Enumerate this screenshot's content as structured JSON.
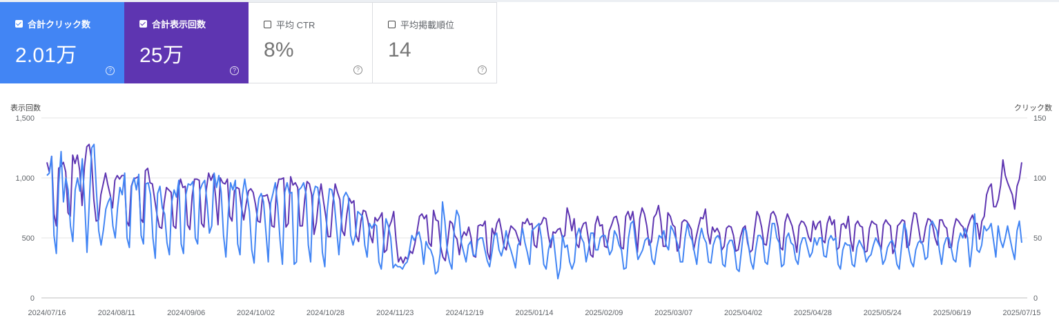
{
  "cards": [
    {
      "label": "合計クリック数",
      "value": "2.01万",
      "checked": true,
      "color": "#4285f4"
    },
    {
      "label": "合計表示回数",
      "value": "25万",
      "checked": true,
      "color": "#5e35b1"
    },
    {
      "label": "平均 CTR",
      "value": "8%",
      "checked": false
    },
    {
      "label": "平均掲載順位",
      "value": "14",
      "checked": false
    }
  ],
  "help_icon": "question-circle-icon",
  "chart_data": {
    "type": "line",
    "left_axis_label": "表示回数",
    "right_axis_label": "クリック数",
    "left_ylim": [
      0,
      1500
    ],
    "right_ylim": [
      0,
      150
    ],
    "left_ticks": [
      "1,500",
      "1,000",
      "500",
      "0"
    ],
    "right_ticks": [
      "150",
      "100",
      "50",
      "0"
    ],
    "x_ticks": [
      "2024/07/16",
      "2024/08/11",
      "2024/09/06",
      "2024/10/02",
      "2024/10/28",
      "2024/11/23",
      "2024/12/19",
      "2025/01/14",
      "2025/02/09",
      "2025/03/07",
      "2025/04/02",
      "2025/04/28",
      "2025/05/24",
      "2025/06/19",
      "2025/07/15"
    ],
    "x_start": "2024/07/16",
    "x_end": "2025/07/15",
    "grid": true,
    "series": [
      {
        "name": "表示回数",
        "axis": "left",
        "color": "#5e35b1",
        "values": [
          1130,
          1050,
          1180,
          700,
          600,
          1080,
          1100,
          1130,
          1050,
          710,
          680,
          1190,
          1120,
          1190,
          1060,
          770,
          1090,
          1260,
          1280,
          1160,
          820,
          640,
          650,
          860,
          950,
          1040,
          940,
          860,
          750,
          980,
          1020,
          990,
          1020,
          1020,
          640,
          600,
          930,
          990,
          1000,
          1010,
          660,
          630,
          1060,
          1080,
          960,
          950,
          820,
          690,
          590,
          580,
          790,
          920,
          900,
          880,
          600,
          580,
          900,
          990,
          920,
          930,
          610,
          570,
          850,
          990,
          990,
          980,
          620,
          590,
          900,
          1040,
          980,
          1030,
          840,
          610,
          1000,
          960,
          950,
          990,
          680,
          640,
          890,
          920,
          910,
          760,
          650,
          780,
          890,
          910,
          880,
          780,
          640,
          630,
          850,
          850,
          860,
          780,
          600,
          590,
          900,
          990,
          990,
          1000,
          590,
          620,
          1010,
          940,
          960,
          920,
          600,
          600,
          820,
          970,
          950,
          860,
          530,
          630,
          830,
          950,
          810,
          680,
          510,
          510,
          780,
          950,
          880,
          820,
          560,
          520,
          700,
          830,
          790,
          810,
          520,
          470,
          640,
          730,
          720,
          640,
          520,
          460,
          670,
          640,
          670,
          710,
          380,
          400,
          590,
          640,
          720,
          480,
          300,
          340,
          290,
          340,
          320,
          390,
          370,
          450,
          560,
          680,
          700,
          660,
          690,
          460,
          430,
          730,
          650,
          640,
          430,
          340,
          310,
          460,
          640,
          620,
          520,
          490,
          360,
          500,
          550,
          520,
          590,
          500,
          350,
          340,
          600,
          610,
          600,
          640,
          380,
          320,
          580,
          520,
          620,
          660,
          560,
          430,
          400,
          520,
          600,
          580,
          560,
          500,
          440,
          630,
          620,
          660,
          610,
          620,
          440,
          420,
          600,
          620,
          670,
          660,
          520,
          420,
          550,
          540,
          570,
          580,
          500,
          520,
          750,
          680,
          560,
          660,
          450,
          420,
          570,
          620,
          630,
          500,
          360,
          340,
          610,
          680,
          600,
          610,
          430,
          420,
          560,
          610,
          670,
          680,
          600,
          420,
          410,
          680,
          720,
          650,
          720,
          570,
          380,
          660,
          750,
          700,
          600,
          440,
          470,
          670,
          700,
          770,
          640,
          430,
          430,
          710,
          680,
          610,
          590,
          390,
          420,
          630,
          650,
          640,
          610,
          570,
          400,
          500,
          590,
          670,
          660,
          740,
          540,
          450,
          590,
          550,
          580,
          540,
          400,
          430,
          580,
          600,
          590,
          520,
          390,
          400,
          510,
          580,
          600,
          460,
          380,
          400,
          570,
          720,
          680,
          590,
          450,
          440,
          580,
          700,
          720,
          680,
          590,
          420,
          400,
          630,
          700,
          650,
          600,
          500,
          380,
          600,
          640,
          630,
          590,
          510,
          470,
          640,
          570,
          620,
          640,
          480,
          460,
          620,
          680,
          610,
          650,
          400,
          420,
          610,
          620,
          580,
          680,
          480,
          390,
          610,
          640,
          600,
          590,
          380,
          390,
          580,
          640,
          620,
          610,
          470,
          400,
          610,
          650,
          620,
          600,
          370,
          420,
          600,
          620,
          650,
          640,
          420,
          440,
          600,
          710,
          700,
          580,
          460,
          470,
          590,
          660,
          650,
          600,
          500,
          440,
          650,
          650,
          600,
          580,
          420,
          420,
          580,
          660,
          640,
          610,
          590,
          500,
          590,
          650,
          690,
          620,
          620,
          490,
          640,
          680,
          860,
          920,
          950,
          760,
          760,
          820,
          940,
          1150,
          1020,
          960,
          910,
          860,
          740,
          930,
          990,
          1130
        ]
      },
      {
        "name": "クリック数",
        "axis": "right",
        "color": "#4285f4",
        "values": [
          102,
          104,
          118,
          52,
          37,
          95,
          122,
          80,
          100,
          90,
          60,
          47,
          90,
          100,
          89,
          116,
          80,
          38,
          80,
          125,
          128,
          90,
          56,
          44,
          57,
          74,
          80,
          84,
          60,
          50,
          75,
          92,
          86,
          104,
          50,
          42,
          93,
          100,
          90,
          103,
          52,
          45,
          95,
          96,
          86,
          50,
          33,
          87,
          93,
          75,
          70,
          46,
          36,
          80,
          90,
          84,
          98,
          45,
          37,
          86,
          95,
          94,
          97,
          50,
          45,
          90,
          95,
          98,
          80,
          54,
          60,
          104,
          92,
          102,
          88,
          52,
          34,
          70,
          96,
          90,
          98,
          45,
          36,
          86,
          99,
          86,
          72,
          40,
          29,
          66,
          83,
          87,
          80,
          55,
          30,
          79,
          87,
          96,
          77,
          48,
          28,
          88,
          96,
          87,
          88,
          28,
          30,
          90,
          92,
          96,
          87,
          44,
          30,
          85,
          93,
          92,
          77,
          38,
          26,
          72,
          91,
          90,
          80,
          58,
          36,
          62,
          84,
          88,
          84,
          52,
          44,
          52,
          72,
          70,
          68,
          44,
          34,
          62,
          58,
          62,
          60,
          30,
          24,
          46,
          66,
          60,
          50,
          25,
          28,
          26,
          26,
          24,
          28,
          30,
          40,
          52,
          48,
          52,
          55,
          46,
          28,
          47,
          42,
          40,
          34,
          20,
          22,
          37,
          80,
          64,
          40,
          30,
          24,
          58,
          73,
          68,
          46,
          38,
          30,
          44,
          47,
          36,
          35,
          48,
          50,
          50,
          40,
          31,
          26,
          38,
          52,
          54,
          40,
          35,
          43,
          56,
          46,
          40,
          33,
          25,
          44,
          47,
          58,
          46,
          38,
          28,
          56,
          58,
          60,
          62,
          50,
          28,
          24,
          40,
          48,
          52,
          34,
          16,
          25,
          52,
          42,
          44,
          30,
          24,
          30,
          52,
          58,
          50,
          46,
          30,
          40,
          54,
          54,
          40,
          40,
          50,
          52,
          52,
          45,
          36,
          40,
          56,
          52,
          44,
          40,
          24,
          25,
          50,
          62,
          64,
          46,
          32,
          36,
          40,
          48,
          50,
          48,
          32,
          28,
          42,
          52,
          50,
          56,
          44,
          40,
          60,
          56,
          50,
          44,
          30,
          30,
          50,
          62,
          52,
          48,
          38,
          28,
          48,
          58,
          50,
          46,
          30,
          29,
          44,
          50,
          52,
          48,
          28,
          26,
          44,
          48,
          48,
          40,
          24,
          22,
          40,
          58,
          56,
          43,
          30,
          24,
          40,
          52,
          52,
          48,
          30,
          28,
          44,
          62,
          62,
          50,
          46,
          26,
          28,
          50,
          54,
          46,
          44,
          32,
          28,
          44,
          50,
          50,
          42,
          34,
          38,
          50,
          44,
          50,
          50,
          35,
          34,
          48,
          52,
          48,
          50,
          28,
          24,
          40,
          46,
          44,
          44,
          28,
          26,
          42,
          48,
          44,
          40,
          30,
          34,
          36,
          44,
          50,
          46,
          42,
          28,
          32,
          42,
          46,
          48,
          42,
          28,
          24,
          44,
          62,
          56,
          40,
          30,
          26,
          40,
          46,
          48,
          44,
          32,
          34,
          60,
          64,
          60,
          56,
          40,
          28,
          44,
          50,
          50,
          42,
          32,
          30,
          46,
          54,
          50,
          58,
          50,
          26,
          44,
          70,
          40,
          38,
          44,
          60,
          56,
          58,
          62,
          48,
          34,
          60,
          48,
          42,
          50,
          60,
          50,
          40,
          32,
          56,
          64,
          46
        ]
      }
    ]
  }
}
